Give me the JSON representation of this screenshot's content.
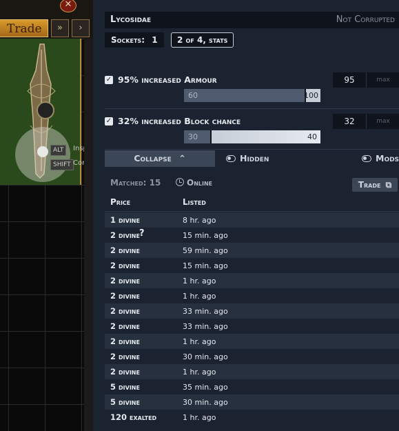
{
  "game": {
    "close_glyph": "✕",
    "trade_tab_label": "Trade",
    "nav_glyphs": [
      "»",
      "›"
    ],
    "keys": [
      {
        "key": "ALT",
        "action": "Inspe"
      },
      {
        "key": "SHIFT",
        "action": "Comp"
      }
    ]
  },
  "item": {
    "name": "Lycosidae",
    "status": "Not Corrupted",
    "sockets_label": "Sockets:",
    "sockets_value": "1",
    "stats_chip": "2 of 4, stats"
  },
  "stats": [
    {
      "label": "95% increased Armour",
      "value": "95",
      "max_placeholder": "max",
      "range_min": "60",
      "range_max": "100",
      "checked": true
    },
    {
      "label": "32% increased Block chance",
      "value": "32",
      "max_placeholder": "max",
      "range_min": "30",
      "range_max": "40",
      "checked": true
    }
  ],
  "controls": {
    "collapse_label": "Collapse",
    "hidden_label": "Hidden",
    "mods_label": "Mods"
  },
  "results": {
    "matched_label": "Matched: 15",
    "online_label": "Online",
    "trade_button_label": "Trade",
    "headers": {
      "price": "Price",
      "listed": "Listed"
    },
    "rows": [
      {
        "price": "1 divine",
        "listed": "8 hr. ago"
      },
      {
        "price": "2 divine",
        "listed": "15 min. ago",
        "uncertain": "?"
      },
      {
        "price": "2 divine",
        "listed": "59 min. ago"
      },
      {
        "price": "2 divine",
        "listed": "15 min. ago"
      },
      {
        "price": "2 divine",
        "listed": "1 hr. ago"
      },
      {
        "price": "2 divine",
        "listed": "1 hr. ago"
      },
      {
        "price": "2 divine",
        "listed": "33 min. ago"
      },
      {
        "price": "2 divine",
        "listed": "33 min. ago"
      },
      {
        "price": "2 divine",
        "listed": "1 hr. ago"
      },
      {
        "price": "2 divine",
        "listed": "30 min. ago"
      },
      {
        "price": "2 divine",
        "listed": "1 hr. ago"
      },
      {
        "price": "5 divine",
        "listed": "35 min. ago"
      },
      {
        "price": "5 divine",
        "listed": "30 min. ago"
      },
      {
        "price": "120 exalted",
        "listed": "1 hr. ago"
      }
    ]
  },
  "colors": {
    "panel_bg": "#1b2330",
    "dark_box": "#0f141c",
    "range_fill_armour": "#3b4657",
    "range_fill_block": "#c7ced8"
  }
}
